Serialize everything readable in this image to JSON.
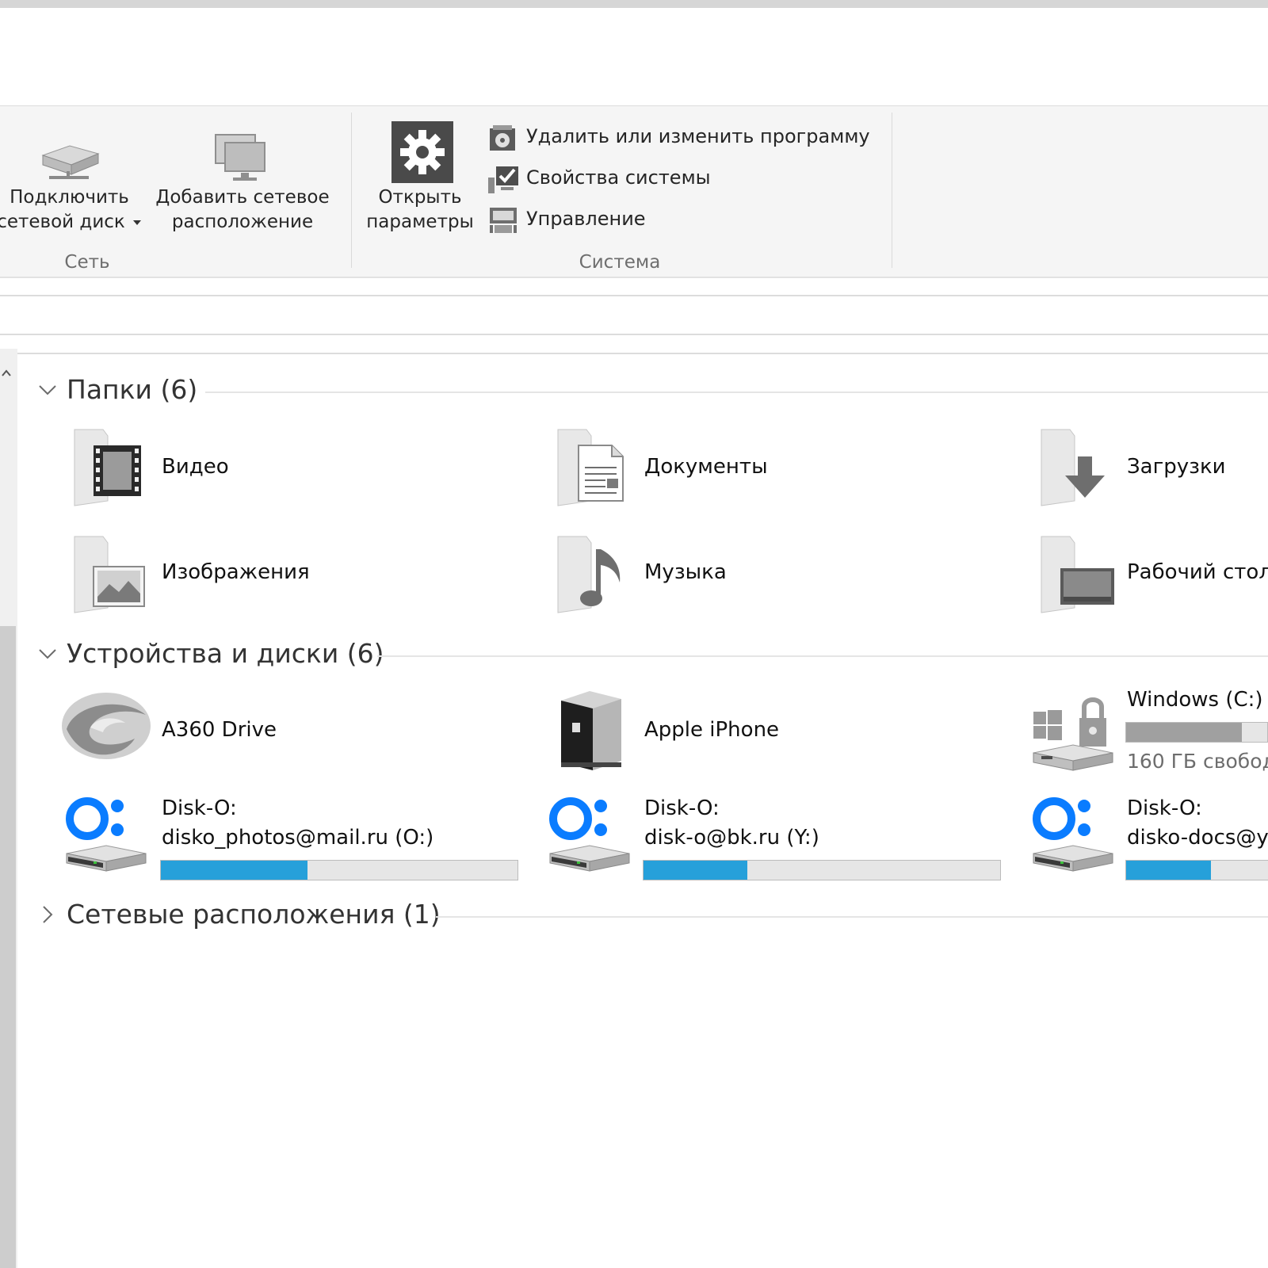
{
  "ribbon": {
    "network": {
      "map_drive_line1": "Подключить",
      "map_drive_line2": "сетевой диск",
      "add_location_line1": "Добавить сетевое",
      "add_location_line2": "расположение",
      "group_label": "Сеть"
    },
    "system": {
      "open_settings_line1": "Открыть",
      "open_settings_line2": "параметры",
      "uninstall": "Удалить или изменить программу",
      "properties": "Свойства системы",
      "manage": "Управление",
      "group_label": "Система"
    }
  },
  "sections": {
    "folders": {
      "title": "Папки (6)",
      "items": [
        "Видео",
        "Документы",
        "Загрузки",
        "Изображения",
        "Музыка",
        "Рабочий стол"
      ]
    },
    "devices": {
      "title": "Устройства и диски (6)",
      "items": [
        {
          "label": "A360 Drive"
        },
        {
          "label": "Apple iPhone"
        },
        {
          "label": "Windows (C:)",
          "free": "160 ГБ свобод",
          "usage": 0.82
        },
        {
          "line1": "Disk-O:",
          "line2": "disko_photos@mail.ru (O:)",
          "usage": 0.41
        },
        {
          "line1": "Disk-O:",
          "line2": "disk-o@bk.ru (Y:)",
          "usage": 0.29
        },
        {
          "line1": "Disk-O:",
          "line2": "disko-docs@y",
          "usage": 0.6
        }
      ]
    },
    "network": {
      "title": "Сетевые расположения (1)"
    }
  },
  "colors": {
    "disko_blue": "#0a7cff",
    "drive_bar_blue": "#26a0da",
    "drive_bar_gray": "#a0a0a0"
  }
}
